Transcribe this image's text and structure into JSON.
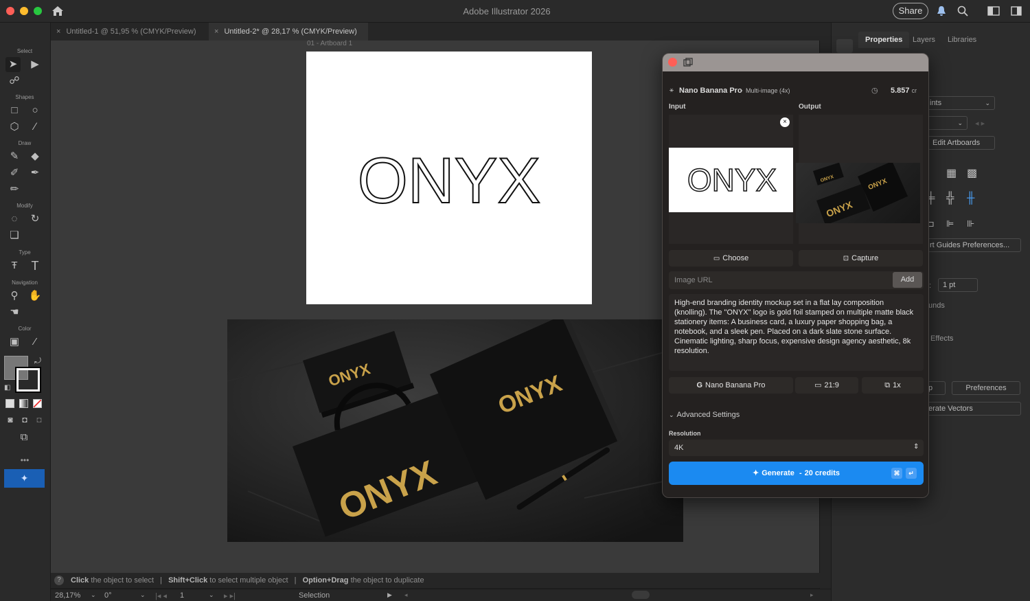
{
  "app": {
    "title": "Adobe Illustrator 2026",
    "share_label": "Share"
  },
  "tabs": [
    {
      "label": "Untitled-1 @ 51,95 % (CMYK/Preview)",
      "close": "×"
    },
    {
      "label": "Untitled-2* @ 28,17 % (CMYK/Preview)",
      "close": "×"
    }
  ],
  "toolbar": {
    "groups": [
      "Select",
      "Shapes",
      "Draw",
      "Modify",
      "Type",
      "Navigation",
      "Color"
    ],
    "more": "•••"
  },
  "artboard": {
    "label": "01 - Artboard 1",
    "logo_text": "ONYX"
  },
  "mockup": {
    "brand": "ONYX"
  },
  "status": {
    "help_icon": "?",
    "hint_parts": [
      {
        "bold": "Click",
        "text": " the object to select"
      },
      {
        "bold": "Shift+Click",
        "text": " to select multiple object"
      },
      {
        "bold": "Option+Drag",
        "text": " the object to duplicate"
      }
    ],
    "sep": "|"
  },
  "bottom": {
    "zoom": "28,17%",
    "rotation": "0°",
    "artboard_num": "1",
    "tool": "Selection"
  },
  "right_panel": {
    "tabs": [
      "Properties",
      "Layers",
      "Libraries"
    ],
    "fragments": {
      "select_value": "ints",
      "edit_artboards": "Edit Artboards",
      "guides": "rt Guides Preferences...",
      "stroke_value": "1 pt",
      "bounds": "unds",
      "effects": "Effects",
      "p_btn": "p",
      "preferences": "Preferences",
      "vectors": "erate Vectors"
    }
  },
  "dialog": {
    "model_name": "Nano Banana Pro",
    "mode": "Multi-image",
    "count": "(4x)",
    "dot": "·",
    "credits_value": "5.857",
    "credits_unit": "cr",
    "input_label": "Input",
    "output_label": "Output",
    "input_logo": "ONYX",
    "choose_label": "Choose",
    "capture_label": "Capture",
    "url_placeholder": "Image URL",
    "add_label": "Add",
    "prompt": "High-end branding identity mockup set in a flat lay composition (knolling). The \"ONYX\" logo is gold foil stamped on multiple matte black stationery items: A business card, a luxury paper shopping bag, a notebook, and a sleek pen. Placed on a dark slate stone surface. Cinematic lighting, sharp focus, expensive design agency aesthetic, 8k resolution.",
    "model_btn": "Nano Banana Pro",
    "ratio_btn": "21:9",
    "count_btn": "1x",
    "advanced_label": "Advanced Settings",
    "resolution_label": "Resolution",
    "resolution_value": "4K",
    "generate_label": "Generate",
    "generate_sep": "-",
    "generate_credits": "20 credits",
    "kbd_cmd": "⌘",
    "kbd_enter": "↵"
  },
  "colors": {
    "accent": "#1b8af1",
    "gold": "#c9a24a",
    "close_red": "#ff5f57"
  }
}
